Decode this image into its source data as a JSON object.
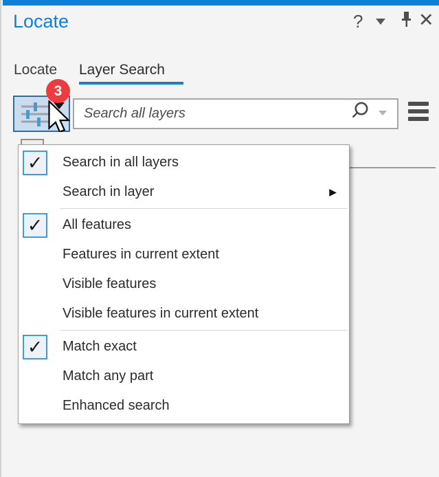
{
  "colors": {
    "accent_blue": "#0d80d6",
    "tab_underline_blue": "#1b7fc8",
    "badge_red": "#ee3b3e"
  },
  "header": {
    "title": "Locate"
  },
  "icons": {
    "help": "?",
    "close": "✕",
    "check": "✓",
    "submenu_arrow": "▶",
    "collapse": "chevron-down",
    "pin": "push-pin",
    "search": "magnifier",
    "menu": "hamburger"
  },
  "tabs": [
    {
      "label": "Locate",
      "active": false
    },
    {
      "label": "Layer Search",
      "active": true
    }
  ],
  "toolbar": {
    "badge": "3",
    "search_placeholder": "Search all layers",
    "search_value": ""
  },
  "menu": {
    "items": [
      {
        "label": "Search in all layers",
        "checked": true
      },
      {
        "label": "Search in layer",
        "checked": false,
        "submenu": true
      },
      {
        "separator": true
      },
      {
        "label": "All features",
        "checked": true
      },
      {
        "label": "Features in current extent",
        "checked": false
      },
      {
        "label": "Visible features",
        "checked": false
      },
      {
        "label": "Visible features in current extent",
        "checked": false
      },
      {
        "separator": true
      },
      {
        "label": "Match exact",
        "checked": true
      },
      {
        "label": "Match any part",
        "checked": false
      },
      {
        "label": "Enhanced search",
        "checked": false
      }
    ]
  }
}
